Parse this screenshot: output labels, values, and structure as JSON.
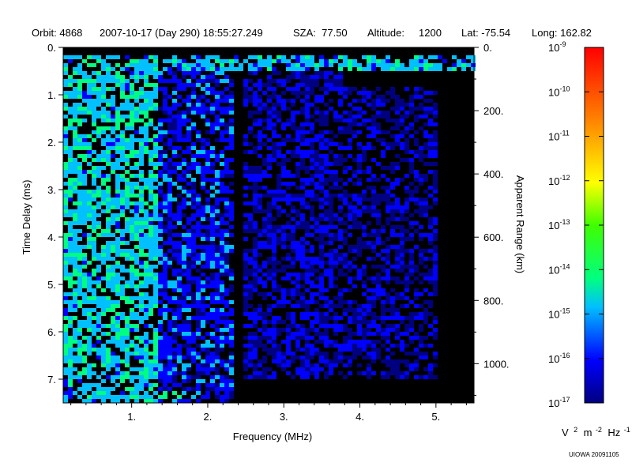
{
  "header": {
    "orbit": "Orbit: 4868",
    "datetime": "2007-10-17 (Day 290) 18:55:27.249",
    "sza": "SZA:  77.50",
    "altitude": "Altitude:     1200",
    "lat": "Lat: -75.54",
    "long": "Long: 162.82"
  },
  "credit": "UIOWA 20091105",
  "colorbar": {
    "base": "10",
    "exponents": [
      "-9",
      "-10",
      "-11",
      "-12",
      "-13",
      "-14",
      "-15",
      "-16",
      "-17"
    ],
    "min_exp": -17,
    "max_exp": -9,
    "unit": {
      "v": "V",
      "e1": "2",
      "m": "m",
      "e2": "-2",
      "hz": "Hz",
      "e3": "-1"
    },
    "colors": [
      "#000080",
      "#0000ff",
      "#00c0ff",
      "#00ff80",
      "#40ff00",
      "#ffff00",
      "#ff8000",
      "#ff0000"
    ]
  },
  "chart_data": {
    "type": "heatmap",
    "title": "",
    "xlabel": "Frequency (MHz)",
    "ylabel": "Time Delay (ms)",
    "y2label": "Apparent Range (km)",
    "xlim": [
      0.1,
      5.5
    ],
    "ylim": [
      0,
      7.5
    ],
    "y2lim": [
      0,
      1124
    ],
    "xticks": [
      1,
      2,
      3,
      4,
      5
    ],
    "xtick_labels": [
      "1.",
      "2.",
      "3.",
      "4.",
      "5."
    ],
    "yticks": [
      0,
      1,
      2,
      3,
      4,
      5,
      6,
      7
    ],
    "ytick_labels": [
      "0.",
      "1.",
      "2.",
      "3.",
      "4.",
      "5.",
      "6.",
      "7."
    ],
    "y2ticks": [
      0,
      200,
      400,
      600,
      800,
      1000
    ],
    "y2tick_labels": [
      "0.",
      "200.",
      "400.",
      "600.",
      "800.",
      "1000."
    ],
    "z_units_log10": "V^2 m^-2 Hz^-1",
    "z_range_log10": [
      -17,
      -9
    ],
    "features": [
      {
        "x": [
          0.1,
          5.5
        ],
        "y": [
          0.2,
          0.5
        ],
        "level": -14.5
      },
      {
        "x": [
          0.1,
          1.35
        ],
        "y": [
          0.2,
          7.5
        ],
        "level": -14.3
      },
      {
        "x": [
          1.35,
          2.35
        ],
        "y": [
          0.5,
          7.5
        ],
        "level": -15.5
      },
      {
        "x": [
          2.45,
          3.8
        ],
        "y": [
          0.5,
          7.0
        ],
        "level": -16.0
      },
      {
        "x": [
          3.8,
          5.0
        ],
        "y": [
          0.8,
          7.0
        ],
        "level": -16.2
      },
      {
        "x": [
          0.1,
          1.3
        ],
        "y": [
          1.5,
          1.7
        ],
        "level": -13.8
      },
      {
        "x": [
          1.3,
          1.85
        ],
        "y": [
          7.25,
          7.4
        ],
        "level": -13.8
      }
    ]
  }
}
